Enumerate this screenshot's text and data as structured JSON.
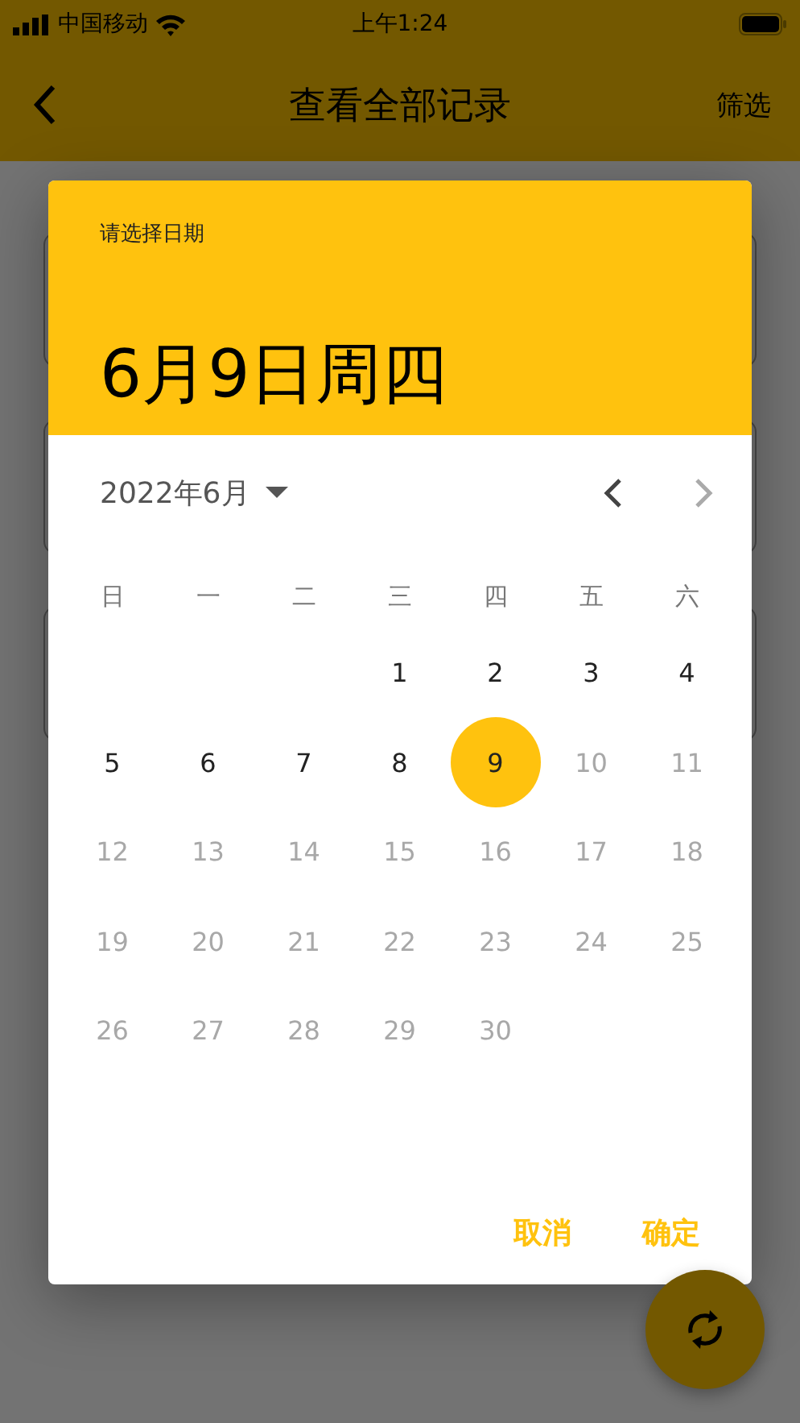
{
  "status_bar": {
    "carrier": "中国移动",
    "time": "上午1:24"
  },
  "app_bar": {
    "title": "查看全部记录",
    "action": "筛选"
  },
  "background_cards": [
    {
      "kind": "card"
    },
    {
      "kind": "card"
    },
    {
      "kind": "card"
    }
  ],
  "dialog": {
    "header_label": "请选择日期",
    "selected_date": "6月9日周四",
    "month_label": "2022年6月",
    "weekdays": [
      "日",
      "一",
      "二",
      "三",
      "四",
      "五",
      "六"
    ],
    "weeks": [
      [
        {
          "kind": "blank"
        },
        {
          "kind": "blank"
        },
        {
          "kind": "blank"
        },
        {
          "kind": "day",
          "label": "1",
          "selected": false,
          "disabled": false
        },
        {
          "kind": "day",
          "label": "2",
          "selected": false,
          "disabled": false
        },
        {
          "kind": "day",
          "label": "3",
          "selected": false,
          "disabled": false
        },
        {
          "kind": "day",
          "label": "4",
          "selected": false,
          "disabled": false
        }
      ],
      [
        {
          "kind": "day",
          "label": "5",
          "selected": false,
          "disabled": false
        },
        {
          "kind": "day",
          "label": "6",
          "selected": false,
          "disabled": false
        },
        {
          "kind": "day",
          "label": "7",
          "selected": false,
          "disabled": false
        },
        {
          "kind": "day",
          "label": "8",
          "selected": false,
          "disabled": false
        },
        {
          "kind": "day",
          "label": "9",
          "selected": true,
          "disabled": false
        },
        {
          "kind": "day",
          "label": "10",
          "selected": false,
          "disabled": true
        },
        {
          "kind": "day",
          "label": "11",
          "selected": false,
          "disabled": true
        }
      ],
      [
        {
          "kind": "day",
          "label": "12",
          "selected": false,
          "disabled": true
        },
        {
          "kind": "day",
          "label": "13",
          "selected": false,
          "disabled": true
        },
        {
          "kind": "day",
          "label": "14",
          "selected": false,
          "disabled": true
        },
        {
          "kind": "day",
          "label": "15",
          "selected": false,
          "disabled": true
        },
        {
          "kind": "day",
          "label": "16",
          "selected": false,
          "disabled": true
        },
        {
          "kind": "day",
          "label": "17",
          "selected": false,
          "disabled": true
        },
        {
          "kind": "day",
          "label": "18",
          "selected": false,
          "disabled": true
        }
      ],
      [
        {
          "kind": "day",
          "label": "19",
          "selected": false,
          "disabled": true
        },
        {
          "kind": "day",
          "label": "20",
          "selected": false,
          "disabled": true
        },
        {
          "kind": "day",
          "label": "21",
          "selected": false,
          "disabled": true
        },
        {
          "kind": "day",
          "label": "22",
          "selected": false,
          "disabled": true
        },
        {
          "kind": "day",
          "label": "23",
          "selected": false,
          "disabled": true
        },
        {
          "kind": "day",
          "label": "24",
          "selected": false,
          "disabled": true
        },
        {
          "kind": "day",
          "label": "25",
          "selected": false,
          "disabled": true
        }
      ],
      [
        {
          "kind": "day",
          "label": "26",
          "selected": false,
          "disabled": true
        },
        {
          "kind": "day",
          "label": "27",
          "selected": false,
          "disabled": true
        },
        {
          "kind": "day",
          "label": "28",
          "selected": false,
          "disabled": true
        },
        {
          "kind": "day",
          "label": "29",
          "selected": false,
          "disabled": true
        },
        {
          "kind": "day",
          "label": "30",
          "selected": false,
          "disabled": true
        }
      ]
    ],
    "next_month_disabled": true,
    "buttons": [
      "取消",
      "确定"
    ]
  }
}
